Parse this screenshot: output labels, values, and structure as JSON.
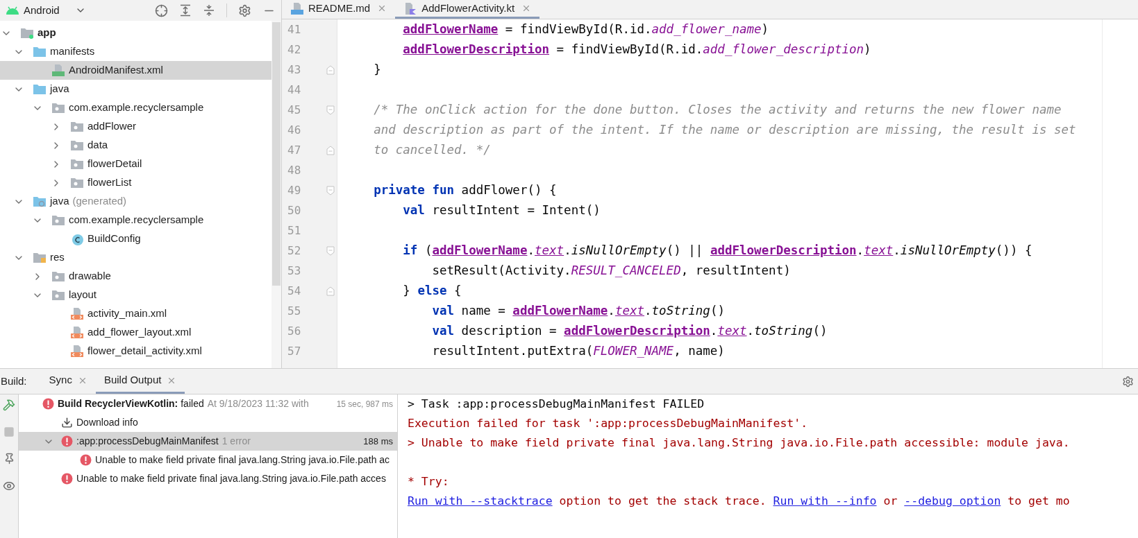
{
  "project_panel": {
    "view": "Android",
    "tree": [
      {
        "label": "app",
        "kind": "module",
        "expanded": true,
        "selected": false,
        "children": [
          {
            "label": "manifests",
            "kind": "source-folder",
            "expanded": true,
            "selected": false,
            "children": [
              {
                "label": "AndroidManifest.xml",
                "kind": "manifest-file",
                "selected": true
              }
            ]
          },
          {
            "label": "java",
            "kind": "source-folder",
            "expanded": true,
            "selected": false,
            "children": [
              {
                "label": "com.example.recyclersample",
                "kind": "package",
                "expanded": true,
                "selected": false,
                "children": [
                  {
                    "label": "addFlower",
                    "kind": "package",
                    "expanded": false,
                    "selected": false
                  },
                  {
                    "label": "data",
                    "kind": "package",
                    "expanded": false,
                    "selected": false
                  },
                  {
                    "label": "flowerDetail",
                    "kind": "package",
                    "expanded": false,
                    "selected": false
                  },
                  {
                    "label": "flowerList",
                    "kind": "package",
                    "expanded": false,
                    "selected": false
                  }
                ]
              }
            ]
          },
          {
            "label": "java",
            "note": "(generated)",
            "kind": "generated-folder",
            "expanded": true,
            "selected": false,
            "children": [
              {
                "label": "com.example.recyclersample",
                "kind": "package",
                "expanded": true,
                "selected": false,
                "children": [
                  {
                    "label": "BuildConfig",
                    "kind": "class",
                    "selected": false
                  }
                ]
              }
            ]
          },
          {
            "label": "res",
            "kind": "resource-folder",
            "expanded": true,
            "selected": false,
            "children": [
              {
                "label": "drawable",
                "kind": "package",
                "expanded": false,
                "selected": false
              },
              {
                "label": "layout",
                "kind": "package",
                "expanded": true,
                "selected": false,
                "children": [
                  {
                    "label": "activity_main.xml",
                    "kind": "layout-file",
                    "selected": false
                  },
                  {
                    "label": "add_flower_layout.xml",
                    "kind": "layout-file",
                    "selected": false
                  },
                  {
                    "label": "flower_detail_activity.xml",
                    "kind": "layout-file",
                    "selected": false
                  }
                ]
              }
            ]
          }
        ]
      }
    ]
  },
  "editor": {
    "tabs": [
      {
        "label": "README.md",
        "kind": "markdown",
        "selected": false
      },
      {
        "label": "AddFlowerActivity.kt",
        "kind": "kotlin",
        "selected": true
      }
    ],
    "lines": [
      {
        "number": "41",
        "kind": "plain",
        "tokens": [
          {
            "t": "        addFlowerName",
            "kind": "field"
          },
          {
            "t": " = findViewById(R.id.",
            "kind": "plain"
          },
          {
            "t": "add_flower_name",
            "kind": "constant"
          },
          {
            "t": ")",
            "kind": "plain"
          }
        ]
      },
      {
        "number": "42",
        "kind": "plain",
        "tokens": [
          {
            "t": "        addFlowerDescription",
            "kind": "field"
          },
          {
            "t": " = findViewById(R.id.",
            "kind": "plain"
          },
          {
            "t": "add_flower_description",
            "kind": "constant"
          },
          {
            "t": ")",
            "kind": "plain"
          }
        ]
      },
      {
        "number": "43",
        "kind": "fold-end",
        "tokens": [
          {
            "t": "    }",
            "kind": "plain"
          }
        ]
      },
      {
        "number": "44",
        "kind": "plain"
      },
      {
        "number": "45",
        "kind": "fold-start",
        "tokens": [
          {
            "t": "    /* The onClick action for the done button. Closes the activity and returns the new flower name",
            "kind": "comment"
          }
        ]
      },
      {
        "number": "46",
        "kind": "plain",
        "tokens": [
          {
            "t": "    and description as part of the intent. If the name or description are missing, the result is set",
            "kind": "comment"
          }
        ]
      },
      {
        "number": "47",
        "kind": "fold-end",
        "tokens": [
          {
            "t": "    to cancelled. */",
            "kind": "comment"
          }
        ]
      },
      {
        "number": "48",
        "kind": "plain"
      },
      {
        "number": "49",
        "kind": "fold-start",
        "tokens": [
          {
            "t": "    private fun",
            "kind": "keyword"
          },
          {
            "t": " addFlower() {",
            "kind": "plain"
          }
        ]
      },
      {
        "number": "50",
        "kind": "plain",
        "tokens": [
          {
            "t": "        val",
            "kind": "keyword"
          },
          {
            "t": " resultIntent = Intent()",
            "kind": "plain"
          }
        ]
      },
      {
        "number": "51",
        "kind": "plain"
      },
      {
        "number": "52",
        "kind": "fold-start",
        "tokens": [
          {
            "t": "        if",
            "kind": "keyword"
          },
          {
            "t": " (",
            "kind": "plain"
          },
          {
            "t": "addFlowerName",
            "kind": "field"
          },
          {
            "t": ".",
            "kind": "plain"
          },
          {
            "t": "text",
            "kind": "property"
          },
          {
            "t": ".",
            "kind": "plain"
          },
          {
            "t": "isNullOrEmpty",
            "kind": "extension"
          },
          {
            "t": "() || ",
            "kind": "plain"
          },
          {
            "t": "addFlowerDescription",
            "kind": "field"
          },
          {
            "t": ".",
            "kind": "plain"
          },
          {
            "t": "text",
            "kind": "property"
          },
          {
            "t": ".",
            "kind": "plain"
          },
          {
            "t": "isNullOrEmpty",
            "kind": "extension"
          },
          {
            "t": "()) {",
            "kind": "plain"
          }
        ]
      },
      {
        "number": "53",
        "kind": "plain",
        "tokens": [
          {
            "t": "            setResult(Activity.",
            "kind": "plain"
          },
          {
            "t": "RESULT_CANCELED",
            "kind": "constant"
          },
          {
            "t": ", resultIntent)",
            "kind": "plain"
          }
        ]
      },
      {
        "number": "54",
        "kind": "fold-end",
        "tokens": [
          {
            "t": "        }",
            "kind": "plain"
          },
          {
            "t": " else",
            "kind": "keyword"
          },
          {
            "t": " {",
            "kind": "plain"
          }
        ]
      },
      {
        "number": "55",
        "kind": "plain",
        "tokens": [
          {
            "t": "            val",
            "kind": "keyword"
          },
          {
            "t": " name = ",
            "kind": "plain"
          },
          {
            "t": "addFlowerName",
            "kind": "field"
          },
          {
            "t": ".",
            "kind": "plain"
          },
          {
            "t": "text",
            "kind": "property"
          },
          {
            "t": ".",
            "kind": "plain"
          },
          {
            "t": "toString",
            "kind": "extension"
          },
          {
            "t": "()",
            "kind": "plain"
          }
        ]
      },
      {
        "number": "56",
        "kind": "plain",
        "tokens": [
          {
            "t": "            val",
            "kind": "keyword"
          },
          {
            "t": " description = ",
            "kind": "plain"
          },
          {
            "t": "addFlowerDescription",
            "kind": "field"
          },
          {
            "t": ".",
            "kind": "plain"
          },
          {
            "t": "text",
            "kind": "property"
          },
          {
            "t": ".",
            "kind": "plain"
          },
          {
            "t": "toString",
            "kind": "extension"
          },
          {
            "t": "()",
            "kind": "plain"
          }
        ]
      },
      {
        "number": "57",
        "kind": "plain",
        "tokens": [
          {
            "t": "            resultIntent.putExtra(",
            "kind": "plain"
          },
          {
            "t": "FLOWER_NAME",
            "kind": "constant"
          },
          {
            "t": ", name)",
            "kind": "plain"
          }
        ]
      }
    ]
  },
  "build_panel": {
    "label": "Build:",
    "tabs": [
      {
        "label": "Sync",
        "selected": false
      },
      {
        "label": "Build Output",
        "selected": true
      }
    ],
    "tree": [
      {
        "kind": "error",
        "title": "Build RecyclerViewKotlin:",
        "status": "failed",
        "detail": "At 9/18/2023 11:32 with",
        "time": "15 sec, 987 ms",
        "selected": false,
        "children": [
          {
            "kind": "download",
            "title": "Download info",
            "selected": false
          },
          {
            "kind": "error",
            "title": ":app:processDebugMainManifest",
            "detail": "1 error",
            "time": "188 ms",
            "expanded": true,
            "selected": true,
            "children": [
              {
                "kind": "error",
                "title": "Unable to make field private final java.lang.String java.io.File.path ac",
                "selected": false
              }
            ]
          },
          {
            "kind": "error",
            "title": "Unable to make field private final java.lang.String java.io.File.path acces",
            "selected": false
          }
        ]
      }
    ],
    "console": [
      [
        {
          "segments": [
            {
              "t": "> Task :app:processDebugMainManifest FAILED",
              "kind": "plain"
            }
          ]
        },
        {
          "segments": [
            {
              "t": "Execution failed for task ':app:processDebugMainManifest'.",
              "kind": "error"
            }
          ]
        },
        {
          "segments": [
            {
              "t": "> Unable to make field private final java.lang.String java.io.File.path accessible: module java.",
              "kind": "error"
            }
          ]
        }
      ],
      [
        {
          "segments": [
            {
              "t": "* Try:",
              "kind": "error"
            }
          ]
        },
        {
          "segments": [
            {
              "t": "Run with --stacktrace",
              "kind": "link"
            },
            {
              "t": " option to get the stack trace. ",
              "kind": "error"
            },
            {
              "t": "Run with --info",
              "kind": "link"
            },
            {
              "t": " or ",
              "kind": "error"
            },
            {
              "t": "--debug option",
              "kind": "link"
            },
            {
              "t": " to get mo",
              "kind": "error"
            }
          ]
        }
      ]
    ]
  }
}
